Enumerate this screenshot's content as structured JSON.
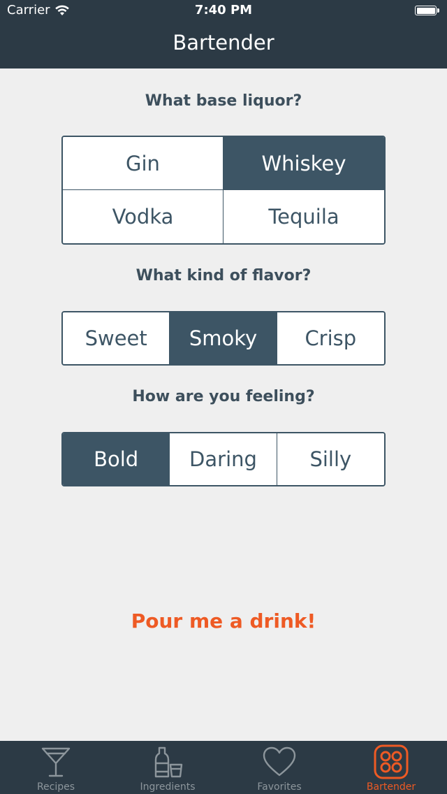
{
  "status_bar": {
    "carrier": "Carrier",
    "time": "7:40 PM"
  },
  "nav": {
    "title": "Bartender"
  },
  "questions": {
    "liquor": {
      "prompt": "What base liquor?",
      "options": [
        "Gin",
        "Whiskey",
        "Vodka",
        "Tequila"
      ],
      "selected": "Whiskey"
    },
    "flavor": {
      "prompt": "What kind of flavor?",
      "options": [
        "Sweet",
        "Smoky",
        "Crisp"
      ],
      "selected": "Smoky"
    },
    "feeling": {
      "prompt": "How are you feeling?",
      "options": [
        "Bold",
        "Daring",
        "Silly"
      ],
      "selected": "Bold"
    }
  },
  "action": {
    "pour_label": "Pour me a drink!"
  },
  "tabbar": {
    "tabs": [
      {
        "label": "Recipes",
        "icon": "martini-glass-icon"
      },
      {
        "label": "Ingredients",
        "icon": "bottle-glass-icon"
      },
      {
        "label": "Favorites",
        "icon": "heart-icon"
      },
      {
        "label": "Bartender",
        "icon": "bartender-grid-icon"
      }
    ],
    "active": "Bartender"
  },
  "colors": {
    "bar_background": "#2c3a45",
    "page_background": "#efefef",
    "selected_fill": "#3d5565",
    "accent": "#ee5a24",
    "inactive_tab": "#8d969c"
  }
}
